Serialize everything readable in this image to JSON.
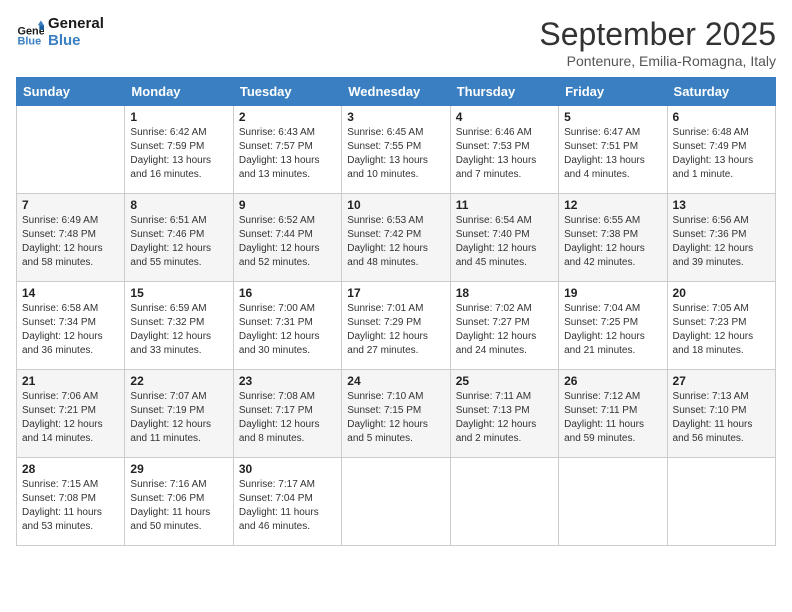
{
  "header": {
    "logo_general": "General",
    "logo_blue": "Blue",
    "month_year": "September 2025",
    "location": "Pontenure, Emilia-Romagna, Italy"
  },
  "weekdays": [
    "Sunday",
    "Monday",
    "Tuesday",
    "Wednesday",
    "Thursday",
    "Friday",
    "Saturday"
  ],
  "weeks": [
    [
      {
        "day": "",
        "sunrise": "",
        "sunset": "",
        "daylight": ""
      },
      {
        "day": "1",
        "sunrise": "Sunrise: 6:42 AM",
        "sunset": "Sunset: 7:59 PM",
        "daylight": "Daylight: 13 hours and 16 minutes."
      },
      {
        "day": "2",
        "sunrise": "Sunrise: 6:43 AM",
        "sunset": "Sunset: 7:57 PM",
        "daylight": "Daylight: 13 hours and 13 minutes."
      },
      {
        "day": "3",
        "sunrise": "Sunrise: 6:45 AM",
        "sunset": "Sunset: 7:55 PM",
        "daylight": "Daylight: 13 hours and 10 minutes."
      },
      {
        "day": "4",
        "sunrise": "Sunrise: 6:46 AM",
        "sunset": "Sunset: 7:53 PM",
        "daylight": "Daylight: 13 hours and 7 minutes."
      },
      {
        "day": "5",
        "sunrise": "Sunrise: 6:47 AM",
        "sunset": "Sunset: 7:51 PM",
        "daylight": "Daylight: 13 hours and 4 minutes."
      },
      {
        "day": "6",
        "sunrise": "Sunrise: 6:48 AM",
        "sunset": "Sunset: 7:49 PM",
        "daylight": "Daylight: 13 hours and 1 minute."
      }
    ],
    [
      {
        "day": "7",
        "sunrise": "Sunrise: 6:49 AM",
        "sunset": "Sunset: 7:48 PM",
        "daylight": "Daylight: 12 hours and 58 minutes."
      },
      {
        "day": "8",
        "sunrise": "Sunrise: 6:51 AM",
        "sunset": "Sunset: 7:46 PM",
        "daylight": "Daylight: 12 hours and 55 minutes."
      },
      {
        "day": "9",
        "sunrise": "Sunrise: 6:52 AM",
        "sunset": "Sunset: 7:44 PM",
        "daylight": "Daylight: 12 hours and 52 minutes."
      },
      {
        "day": "10",
        "sunrise": "Sunrise: 6:53 AM",
        "sunset": "Sunset: 7:42 PM",
        "daylight": "Daylight: 12 hours and 48 minutes."
      },
      {
        "day": "11",
        "sunrise": "Sunrise: 6:54 AM",
        "sunset": "Sunset: 7:40 PM",
        "daylight": "Daylight: 12 hours and 45 minutes."
      },
      {
        "day": "12",
        "sunrise": "Sunrise: 6:55 AM",
        "sunset": "Sunset: 7:38 PM",
        "daylight": "Daylight: 12 hours and 42 minutes."
      },
      {
        "day": "13",
        "sunrise": "Sunrise: 6:56 AM",
        "sunset": "Sunset: 7:36 PM",
        "daylight": "Daylight: 12 hours and 39 minutes."
      }
    ],
    [
      {
        "day": "14",
        "sunrise": "Sunrise: 6:58 AM",
        "sunset": "Sunset: 7:34 PM",
        "daylight": "Daylight: 12 hours and 36 minutes."
      },
      {
        "day": "15",
        "sunrise": "Sunrise: 6:59 AM",
        "sunset": "Sunset: 7:32 PM",
        "daylight": "Daylight: 12 hours and 33 minutes."
      },
      {
        "day": "16",
        "sunrise": "Sunrise: 7:00 AM",
        "sunset": "Sunset: 7:31 PM",
        "daylight": "Daylight: 12 hours and 30 minutes."
      },
      {
        "day": "17",
        "sunrise": "Sunrise: 7:01 AM",
        "sunset": "Sunset: 7:29 PM",
        "daylight": "Daylight: 12 hours and 27 minutes."
      },
      {
        "day": "18",
        "sunrise": "Sunrise: 7:02 AM",
        "sunset": "Sunset: 7:27 PM",
        "daylight": "Daylight: 12 hours and 24 minutes."
      },
      {
        "day": "19",
        "sunrise": "Sunrise: 7:04 AM",
        "sunset": "Sunset: 7:25 PM",
        "daylight": "Daylight: 12 hours and 21 minutes."
      },
      {
        "day": "20",
        "sunrise": "Sunrise: 7:05 AM",
        "sunset": "Sunset: 7:23 PM",
        "daylight": "Daylight: 12 hours and 18 minutes."
      }
    ],
    [
      {
        "day": "21",
        "sunrise": "Sunrise: 7:06 AM",
        "sunset": "Sunset: 7:21 PM",
        "daylight": "Daylight: 12 hours and 14 minutes."
      },
      {
        "day": "22",
        "sunrise": "Sunrise: 7:07 AM",
        "sunset": "Sunset: 7:19 PM",
        "daylight": "Daylight: 12 hours and 11 minutes."
      },
      {
        "day": "23",
        "sunrise": "Sunrise: 7:08 AM",
        "sunset": "Sunset: 7:17 PM",
        "daylight": "Daylight: 12 hours and 8 minutes."
      },
      {
        "day": "24",
        "sunrise": "Sunrise: 7:10 AM",
        "sunset": "Sunset: 7:15 PM",
        "daylight": "Daylight: 12 hours and 5 minutes."
      },
      {
        "day": "25",
        "sunrise": "Sunrise: 7:11 AM",
        "sunset": "Sunset: 7:13 PM",
        "daylight": "Daylight: 12 hours and 2 minutes."
      },
      {
        "day": "26",
        "sunrise": "Sunrise: 7:12 AM",
        "sunset": "Sunset: 7:11 PM",
        "daylight": "Daylight: 11 hours and 59 minutes."
      },
      {
        "day": "27",
        "sunrise": "Sunrise: 7:13 AM",
        "sunset": "Sunset: 7:10 PM",
        "daylight": "Daylight: 11 hours and 56 minutes."
      }
    ],
    [
      {
        "day": "28",
        "sunrise": "Sunrise: 7:15 AM",
        "sunset": "Sunset: 7:08 PM",
        "daylight": "Daylight: 11 hours and 53 minutes."
      },
      {
        "day": "29",
        "sunrise": "Sunrise: 7:16 AM",
        "sunset": "Sunset: 7:06 PM",
        "daylight": "Daylight: 11 hours and 50 minutes."
      },
      {
        "day": "30",
        "sunrise": "Sunrise: 7:17 AM",
        "sunset": "Sunset: 7:04 PM",
        "daylight": "Daylight: 11 hours and 46 minutes."
      },
      {
        "day": "",
        "sunrise": "",
        "sunset": "",
        "daylight": ""
      },
      {
        "day": "",
        "sunrise": "",
        "sunset": "",
        "daylight": ""
      },
      {
        "day": "",
        "sunrise": "",
        "sunset": "",
        "daylight": ""
      },
      {
        "day": "",
        "sunrise": "",
        "sunset": "",
        "daylight": ""
      }
    ]
  ]
}
